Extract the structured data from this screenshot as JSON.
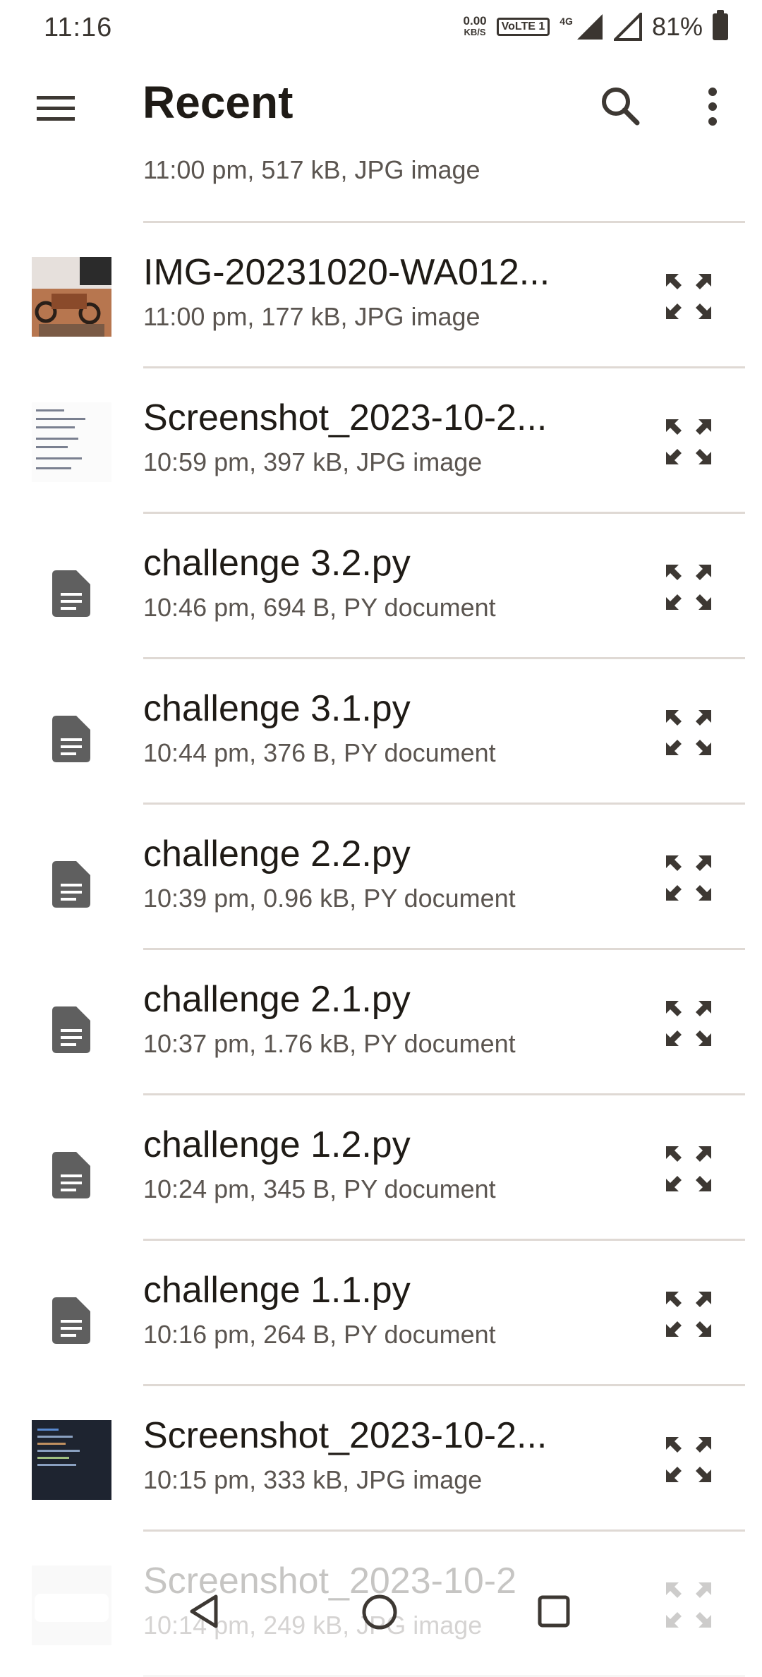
{
  "status_bar": {
    "time": "11:16",
    "speed_value": "0.00",
    "speed_unit": "KB/S",
    "volte": "VoLTE 1",
    "network": "4G",
    "battery": "81%"
  },
  "app_bar": {
    "title": "Recent",
    "icons": [
      "menu-icon",
      "search-icon",
      "more-vert-icon"
    ]
  },
  "files": [
    {
      "name": "",
      "meta": "11:00 pm, 517 kB, JPG image",
      "kind": "image",
      "thumb": "doc-screenshot"
    },
    {
      "name": "IMG-20231020-WA012...",
      "meta": "11:00 pm, 177 kB, JPG image",
      "kind": "image",
      "thumb": "photo"
    },
    {
      "name": "Screenshot_2023-10-2...",
      "meta": "10:59 pm, 397 kB, JPG image",
      "kind": "image",
      "thumb": "doc-screenshot"
    },
    {
      "name": "challenge 3.2.py",
      "meta": "10:46 pm, 694 B, PY document",
      "kind": "document"
    },
    {
      "name": "challenge 3.1.py",
      "meta": "10:44 pm, 376 B, PY document",
      "kind": "document"
    },
    {
      "name": "challenge 2.2.py",
      "meta": "10:39 pm, 0.96 kB, PY document",
      "kind": "document"
    },
    {
      "name": "challenge 2.1.py",
      "meta": "10:37 pm, 1.76 kB, PY document",
      "kind": "document"
    },
    {
      "name": "challenge 1.2.py",
      "meta": "10:24 pm, 345 B, PY document",
      "kind": "document"
    },
    {
      "name": "challenge 1.1.py",
      "meta": "10:16 pm, 264 B, PY document",
      "kind": "document"
    },
    {
      "name": "Screenshot_2023-10-2...",
      "meta": "10:15 pm, 333 kB, JPG image",
      "kind": "image",
      "thumb": "dark-screenshot"
    },
    {
      "name": "Screenshot_2023-10-2",
      "meta": "10:14 pm, 249 kB, JPG image",
      "kind": "image",
      "thumb": "light-screenshot"
    }
  ],
  "colors": {
    "text_primary": "#1f1b16",
    "text_secondary": "#5b5550",
    "icon": "#3d3833",
    "divider": "#dfd9d4",
    "doc_icon": "#5f5f5f"
  },
  "nav_bar": {
    "icons": [
      "back-icon",
      "home-icon",
      "recents-icon"
    ]
  }
}
